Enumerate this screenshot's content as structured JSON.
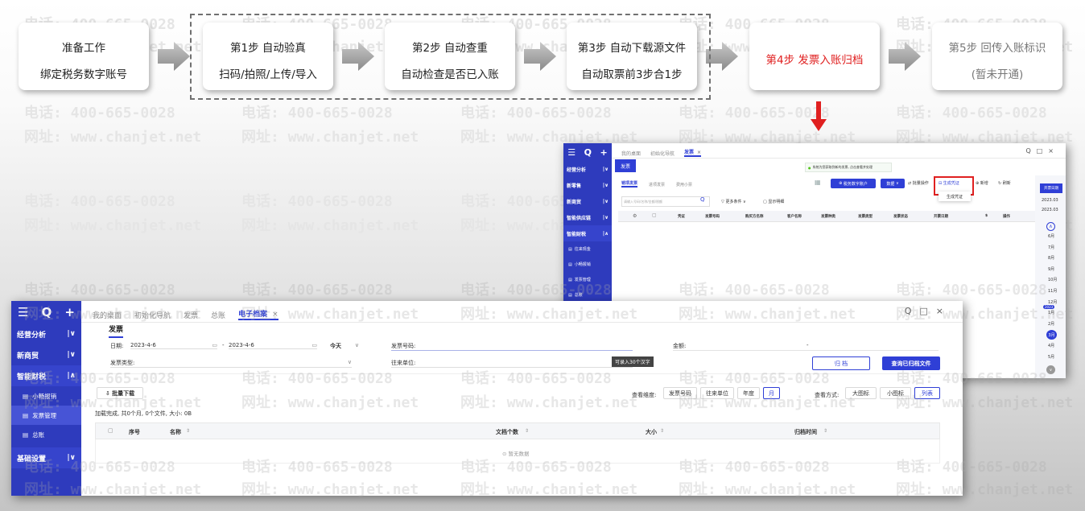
{
  "watermark": {
    "phone": "电话: 400-665-0028",
    "site": "网址: www.chanjet.net"
  },
  "flow": [
    {
      "line1": "准备工作",
      "line2": "绑定税务数字账号"
    },
    {
      "line1": "第1步 自动验真",
      "line2": "扫码/拍照/上传/导入"
    },
    {
      "line1": "第2步 自动查重",
      "line2": "自动检查是否已入账"
    },
    {
      "line1": "第3步 自动下载源文件",
      "line2": "自动取票前3步合1步"
    },
    {
      "line1": "第4步 发票入账归档",
      "line2": ""
    },
    {
      "line1": "第5步 回传入账标识",
      "line2": "(暂未开通)"
    }
  ],
  "colors": {
    "brand": "#2e3bbd",
    "accent": "#2f3fd6",
    "highlight": "#e02020"
  },
  "invoice_window": {
    "tabs": [
      "我的桌面",
      "初始化导航",
      "发票"
    ],
    "close_glyph": "×",
    "win_controls": [
      "Q",
      "□",
      "×"
    ],
    "sidebar": [
      "经营分析",
      "新零售",
      "新商贸",
      "智能供应链",
      "智能财税"
    ],
    "sub_items": [
      "往来现金",
      "小畅报销",
      "发票管理",
      "总账"
    ],
    "page_title": "发票",
    "notice": "系统为您获取到新的发票, 点击查看并处理",
    "sub_tabs": [
      "销项发票",
      "进项发票",
      "费用小票"
    ],
    "search_placeholder": "请输入号码/名称/金额/税额",
    "more_filter": "更多条件",
    "show_detail": "显示明细",
    "tax_account_btn": "税务数字账户",
    "import_btn": "数据",
    "batch_ops": "批量操作",
    "gen_voucher": "生成凭证",
    "add": "新增",
    "refresh": "刷新",
    "dropdown_item": "生成凭证",
    "columns": [
      "凭证",
      "发票号码",
      "购买方名称",
      "客户名称",
      "发票种类",
      "发票类型",
      "发票状态",
      "开票日期",
      "$",
      "操作"
    ],
    "right_panel": {
      "header": "开票日期",
      "years": [
        "2023.03",
        "2023.03"
      ],
      "months": [
        "6月",
        "7月",
        "8月",
        "9月",
        "10月",
        "11月",
        "12月",
        "1月",
        "2月",
        "3月",
        "4月",
        "5月"
      ],
      "year_badge": "2023",
      "current_month": "3月"
    }
  },
  "archive_window": {
    "tabs": [
      "我的桌面",
      "初始化导航",
      "发票",
      "总账",
      "电子档案"
    ],
    "close_glyph": "×",
    "win_controls": [
      "Q",
      "□",
      "×"
    ],
    "sidebar": [
      "经营分析",
      "新商贸",
      "智能财税"
    ],
    "sub_items": [
      "小畅报销",
      "发票管理",
      "总账"
    ],
    "sidebar_bottom": "基础设置",
    "page_tab": "发票",
    "date_label": "日期:",
    "date_from": "2023-4-6",
    "date_to": "2023-4-6",
    "date_sep": "-",
    "today": "今天",
    "invoice_type_label": "发票类型:",
    "invoice_no_label": "发票号码:",
    "counterparty_label": "往来单位:",
    "tooltip": "可录入30个汉字",
    "amount_label": "金额:",
    "amount_sep": "-",
    "archive_btn": "归 档",
    "query_btn": "查询已归档文件",
    "batch_download": "批量下载",
    "status": "加载完成, 共0个月, 0个文件, 大小: 0B",
    "dimension_label": "查看维度:",
    "dimensions": [
      "发票号码",
      "往来单位",
      "年度",
      "月"
    ],
    "view_label": "查看方式:",
    "views": [
      "大图标",
      "小图标",
      "列表"
    ],
    "columns": [
      "序号",
      "名称",
      "文档个数",
      "大小",
      "归档时间"
    ],
    "empty": "暂无数据"
  }
}
